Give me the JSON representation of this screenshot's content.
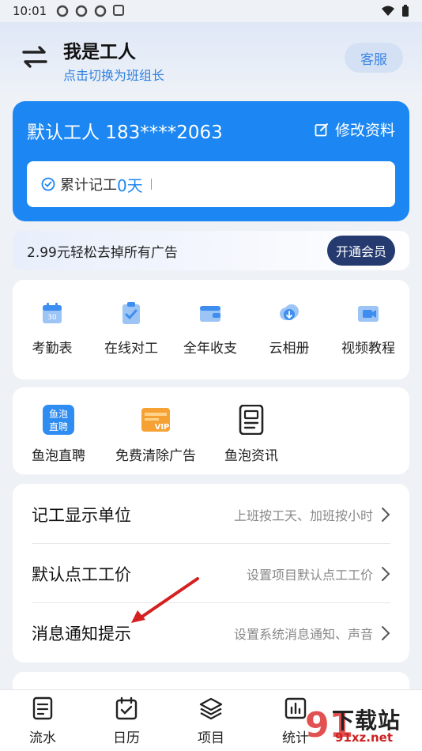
{
  "status_bar": {
    "time": "10:01"
  },
  "header": {
    "title": "我是工人",
    "subtitle": "点击切换为班组长",
    "service_label": "客服"
  },
  "profile": {
    "name_phone": "默认工人 183****2063",
    "edit_label": "修改资料",
    "days_label": "累计记工",
    "days_value": "0天"
  },
  "vip": {
    "text": "2.99元轻松去掉所有广告",
    "button": "开通会员"
  },
  "tools": [
    {
      "label": "考勤表",
      "icon": "calendar-icon"
    },
    {
      "label": "在线对工",
      "icon": "clipboard-check-icon"
    },
    {
      "label": "全年收支",
      "icon": "wallet-icon"
    },
    {
      "label": "云相册",
      "icon": "cloud-download-icon"
    },
    {
      "label": "视频教程",
      "icon": "video-icon"
    }
  ],
  "promos": [
    {
      "label": "鱼泡直聘",
      "icon": "yupao-recruit-icon",
      "icon_text_1": "鱼泡",
      "icon_text_2": "直聘"
    },
    {
      "label": "免费清除广告",
      "icon": "vip-card-icon",
      "icon_text": "VIP"
    },
    {
      "label": "鱼泡资讯",
      "icon": "news-document-icon"
    }
  ],
  "settings": [
    {
      "title": "记工显示单位",
      "desc": "上班按工天、加班按小时"
    },
    {
      "title": "默认点工工价",
      "desc": "设置项目默认点工工价"
    },
    {
      "title": "消息通知提示",
      "desc": "设置系统消息通知、声音"
    }
  ],
  "tabs": [
    {
      "label": "流水",
      "icon": "list-document-icon"
    },
    {
      "label": "日历",
      "icon": "calendar-check-icon"
    },
    {
      "label": "项目",
      "icon": "layers-icon"
    },
    {
      "label": "统计",
      "icon": "bar-chart-icon"
    }
  ],
  "watermark": {
    "text": "下载站",
    "domain": "91xz.net",
    "number": "91"
  },
  "colors": {
    "primary": "#1c87f2",
    "vip_button": "#253a6f",
    "annotation_arrow": "#d42020"
  }
}
